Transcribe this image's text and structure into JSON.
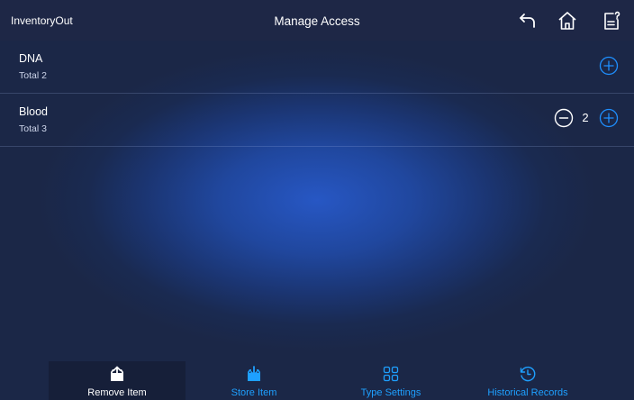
{
  "header": {
    "app_name": "InventoryOut",
    "title": "Manage Access",
    "icons": [
      "back-arrow-icon",
      "home-icon",
      "clipboard-help-icon"
    ]
  },
  "items": [
    {
      "name": "DNA",
      "total": "Total 2",
      "quantity": null
    },
    {
      "name": "Blood",
      "total": "Total 3",
      "quantity": "2"
    }
  ],
  "bottom_nav": {
    "items": [
      {
        "label": "Remove Item",
        "icon": "tray-upload-icon",
        "active": true
      },
      {
        "label": "Store Item",
        "icon": "tray-download-icon",
        "active": false
      },
      {
        "label": "Type Settings",
        "icon": "grid-icon",
        "active": false
      },
      {
        "label": "Historical Records",
        "icon": "history-clock-icon",
        "active": false
      }
    ]
  },
  "colors": {
    "header_bg": "#1e2746",
    "accent": "#1ea0ff",
    "nav_active_bg": "#161f39",
    "text": "#ffffff"
  }
}
